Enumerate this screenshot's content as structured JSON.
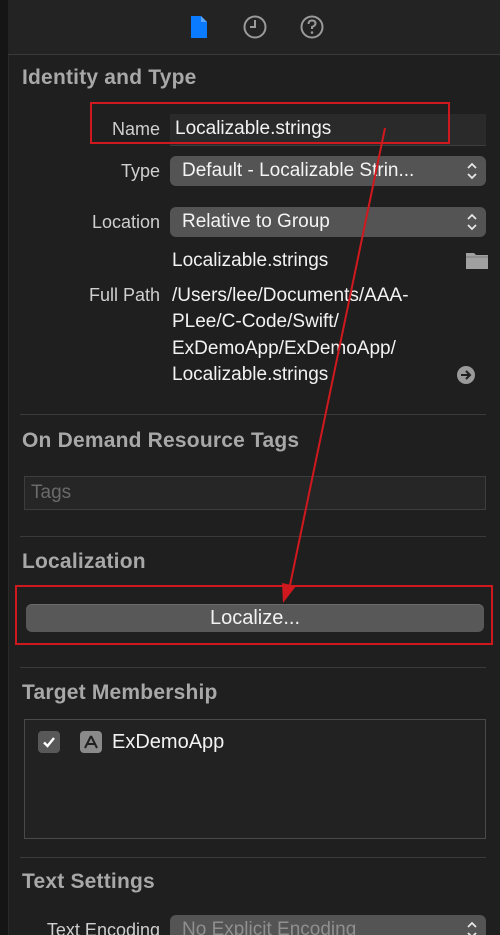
{
  "toolbar": {
    "tabs": [
      {
        "icon": "file-icon",
        "active": true
      },
      {
        "icon": "history-clock-icon",
        "active": false
      },
      {
        "icon": "help-icon",
        "active": false
      }
    ]
  },
  "identity": {
    "title": "Identity and Type",
    "name_label": "Name",
    "name_value": "Localizable.strings",
    "type_label": "Type",
    "type_value": "Default - Localizable Strin...",
    "location_label": "Location",
    "location_value": "Relative to Group",
    "location_filename": "Localizable.strings",
    "fullpath_label": "Full Path",
    "fullpath_lines": [
      "/Users/lee/Documents/AAA-",
      "PLee/C-Code/Swift/",
      "ExDemoApp/ExDemoApp/",
      "Localizable.strings"
    ]
  },
  "tags": {
    "title": "On Demand Resource Tags",
    "placeholder": "Tags"
  },
  "localization": {
    "title": "Localization",
    "button_label": "Localize..."
  },
  "membership": {
    "title": "Target Membership",
    "targets": [
      {
        "name": "ExDemoApp",
        "checked": true
      }
    ]
  },
  "text_settings": {
    "title": "Text Settings",
    "encoding_label": "Text Encoding",
    "encoding_value": "No Explicit Encoding"
  },
  "colors": {
    "accent": "#0a7aff",
    "annotation_red": "#d0191f",
    "background": "#1f1f1f"
  }
}
